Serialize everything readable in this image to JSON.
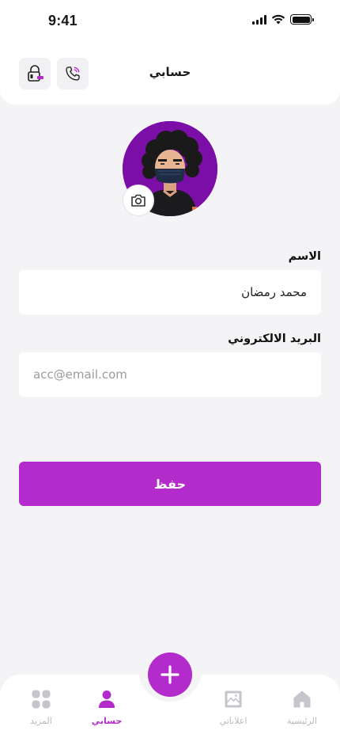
{
  "status_bar": {
    "time": "9:41"
  },
  "header": {
    "title": "حسابي",
    "lock_icon": "lock-icon",
    "call_icon": "phone-call-icon"
  },
  "profile": {
    "avatar_bg": "#7b0ea6",
    "camera_icon": "camera-icon"
  },
  "form": {
    "name_label": "الاسم",
    "name_value": "محمد رمضان",
    "email_label": "البريد الالكتروني",
    "email_placeholder": "acc@email.com"
  },
  "save_button": {
    "label": "حفظ"
  },
  "bottom_nav": {
    "items": [
      {
        "label": "الرئيسية",
        "icon": "home-icon",
        "active": false
      },
      {
        "label": "اعلاناتي",
        "icon": "image-icon",
        "active": false
      },
      {
        "label": "حسابي",
        "icon": "user-icon",
        "active": true
      },
      {
        "label": "المزيد",
        "icon": "grid-icon",
        "active": false
      }
    ],
    "fab_icon": "plus-icon"
  },
  "colors": {
    "accent": "#b42bcb",
    "background": "#f4f4f6",
    "inactive": "#c5c5cb"
  }
}
